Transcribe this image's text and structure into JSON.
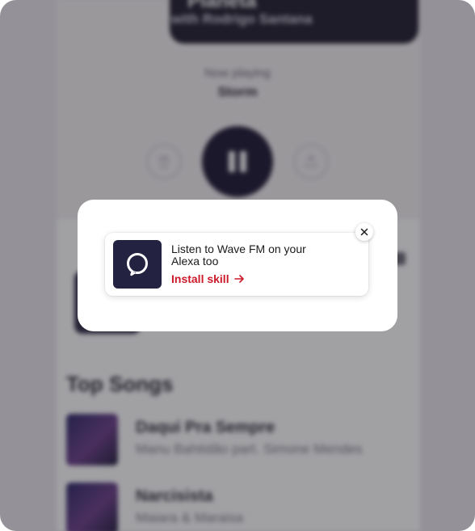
{
  "background": {
    "hero_title": "Planeta",
    "hero_subtitle": "with Rodrigo Santana",
    "now_playing_label": "Now playing",
    "now_playing_title": "Storm",
    "section_title": "Top Songs",
    "songs": [
      {
        "title": "Daqui Pra Sempre",
        "artist": "Manu Bahtidão part. Simone Mendes"
      },
      {
        "title": "Narcisista",
        "artist": "Maiara & Maraisa"
      }
    ]
  },
  "popup": {
    "message": "Listen to Wave FM on your Alexa too",
    "link_label": "Install skill",
    "icon": "alexa-logo-icon",
    "close_icon": "close-icon",
    "link_color": "#cc1a2b",
    "tile_color": "#232240"
  }
}
